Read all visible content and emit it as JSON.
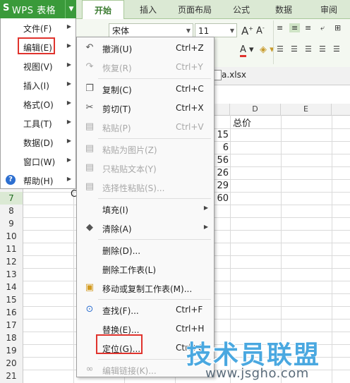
{
  "app": {
    "logo": "S",
    "name": "WPS 表格"
  },
  "ribbon": {
    "tabs": [
      "开始",
      "插入",
      "页面布局",
      "公式",
      "数据",
      "审阅"
    ],
    "active_tab": "开始",
    "font_name": "宋体",
    "font_size": "11"
  },
  "file": {
    "name": "a.xlsx"
  },
  "left_menu": [
    {
      "label": "文件(F)"
    },
    {
      "label": "编辑(E)"
    },
    {
      "label": "视图(V)"
    },
    {
      "label": "插入(I)"
    },
    {
      "label": "格式(O)"
    },
    {
      "label": "工具(T)"
    },
    {
      "label": "数据(D)"
    },
    {
      "label": "窗口(W)"
    },
    {
      "label": "帮助(H)"
    }
  ],
  "edit_menu": [
    {
      "label": "撤消(U)",
      "shortcut": "Ctrl+Z",
      "icon": "undo-icon",
      "disabled": false
    },
    {
      "label": "恢复(R)",
      "shortcut": "Ctrl+Y",
      "icon": "redo-icon",
      "disabled": true
    },
    {
      "label": "复制(C)",
      "shortcut": "Ctrl+C",
      "icon": "copy-icon",
      "disabled": false
    },
    {
      "label": "剪切(T)",
      "shortcut": "Ctrl+X",
      "icon": "scissors-icon",
      "disabled": false
    },
    {
      "label": "粘贴(P)",
      "shortcut": "Ctrl+V",
      "icon": "paste-icon",
      "disabled": true
    },
    {
      "label": "粘贴为图片(Z)",
      "shortcut": "",
      "icon": "paste-image-icon",
      "disabled": true
    },
    {
      "label": "只粘贴文本(Y)",
      "shortcut": "",
      "icon": "paste-text-icon",
      "disabled": true
    },
    {
      "label": "选择性粘贴(S)...",
      "shortcut": "",
      "icon": "paste-special-icon",
      "disabled": true
    },
    {
      "label": "填充(I)",
      "shortcut": "",
      "icon": "",
      "disabled": false,
      "submenu": true
    },
    {
      "label": "清除(A)",
      "shortcut": "",
      "icon": "eraser-icon",
      "disabled": false,
      "submenu": true
    },
    {
      "label": "删除(D)...",
      "shortcut": "",
      "icon": "",
      "disabled": false
    },
    {
      "label": "删除工作表(L)",
      "shortcut": "",
      "icon": "",
      "disabled": false
    },
    {
      "label": "移动或复制工作表(M)...",
      "shortcut": "",
      "icon": "move-sheet-icon",
      "disabled": false
    },
    {
      "label": "查找(F)...",
      "shortcut": "Ctrl+F",
      "icon": "find-icon",
      "disabled": false
    },
    {
      "label": "替换(E)...",
      "shortcut": "Ctrl+H",
      "icon": "",
      "disabled": false
    },
    {
      "label": "定位(G)...",
      "shortcut": "Ctrl+G",
      "icon": "",
      "disabled": false
    },
    {
      "label": "编辑链接(K)...",
      "shortcut": "",
      "icon": "link-icon",
      "disabled": true
    }
  ],
  "sheet": {
    "columns": [
      "D",
      "E"
    ],
    "header_cell": "总价",
    "values": [
      "15",
      "6",
      "56",
      "26",
      "29",
      "60"
    ],
    "row_numbers": [
      "7",
      "8",
      "9",
      "10",
      "11",
      "12",
      "13",
      "14",
      "15",
      "16",
      "17",
      "18",
      "19",
      "20",
      "21"
    ],
    "selected_row": "7",
    "partial_cell": "C"
  },
  "watermark": {
    "title": "技术员联盟",
    "url": "www.jsgho.com"
  },
  "colors": {
    "accent": "#3a9a3a",
    "highlight_box": "#e0332d"
  }
}
